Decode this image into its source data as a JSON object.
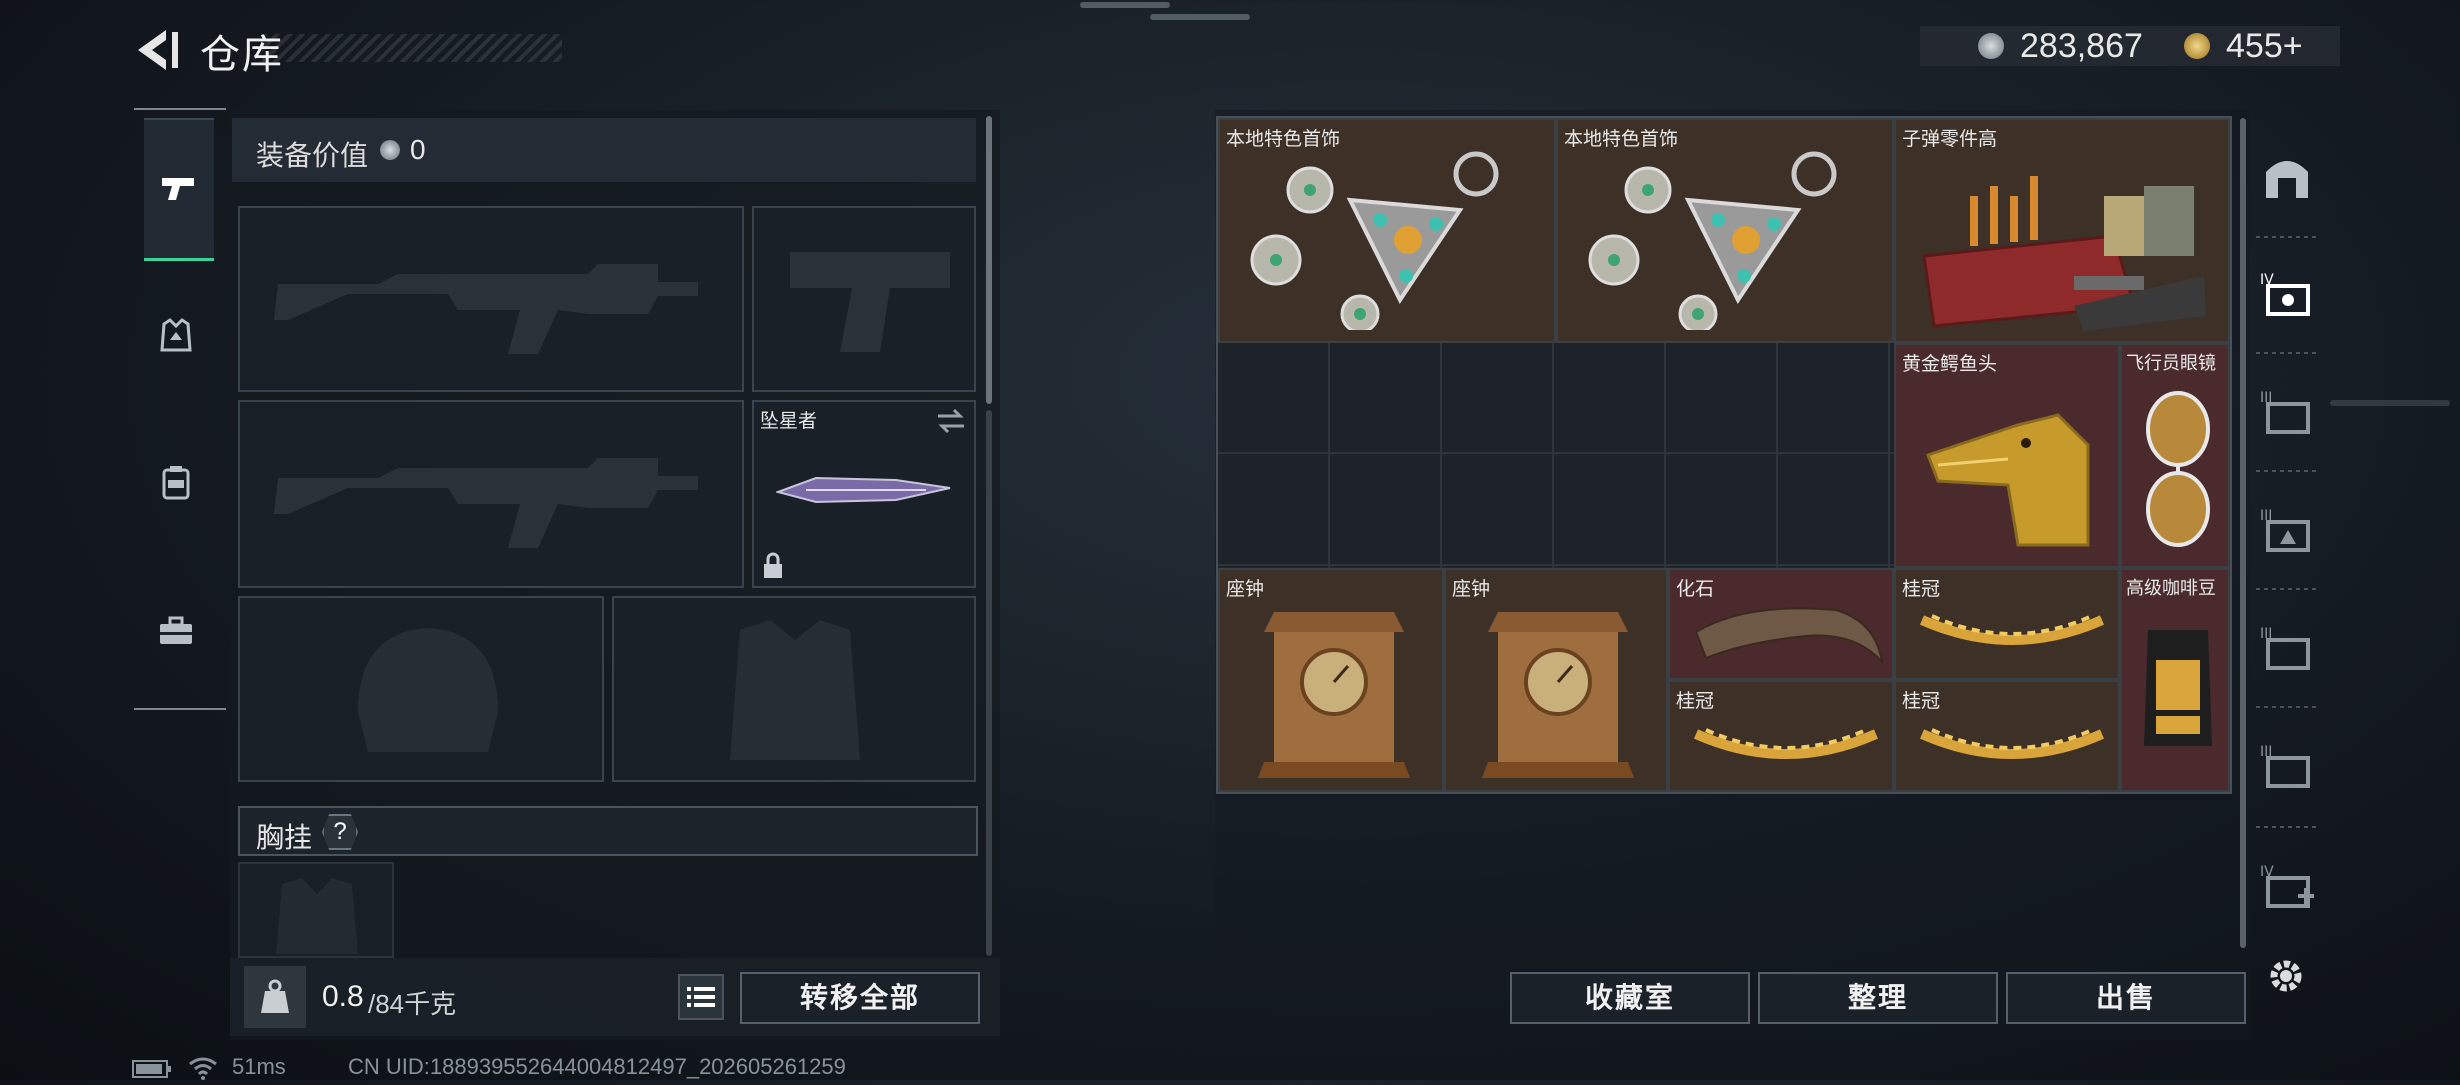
{
  "header": {
    "title": "仓库"
  },
  "currency": {
    "silver": "283,867",
    "gold": "455+"
  },
  "loadout": {
    "equipment_value_label": "装备价值",
    "equipment_value": "0",
    "melee_name": "坠星者",
    "chest_rig_label": "胸挂",
    "chest_rig_help": "?",
    "weight_current": "0.8",
    "weight_max": "/84千克",
    "transfer_all_label": "转移全部"
  },
  "stash": {
    "items": [
      {
        "name": "本地特色首饰"
      },
      {
        "name": "本地特色首饰"
      },
      {
        "name": "子弹零件高"
      },
      {
        "name": "黄金鳄鱼头"
      },
      {
        "name": "飞行员眼镜"
      },
      {
        "name": "座钟"
      },
      {
        "name": "座钟"
      },
      {
        "name": "化石"
      },
      {
        "name": "桂冠"
      },
      {
        "name": "高级咖啡豆"
      },
      {
        "name": "桂冠"
      },
      {
        "name": "桂冠"
      }
    ],
    "buttons": {
      "collection": "收藏室",
      "sort": "整理",
      "sell": "出售"
    }
  },
  "status_bar": {
    "ping": "51ms",
    "uid": "CN UID:1889395526440048124​97_202605261259"
  },
  "colors": {
    "accent": "#3ad39a",
    "rare_bg": "#4a2a2d",
    "common_bg": "#3d3027"
  }
}
